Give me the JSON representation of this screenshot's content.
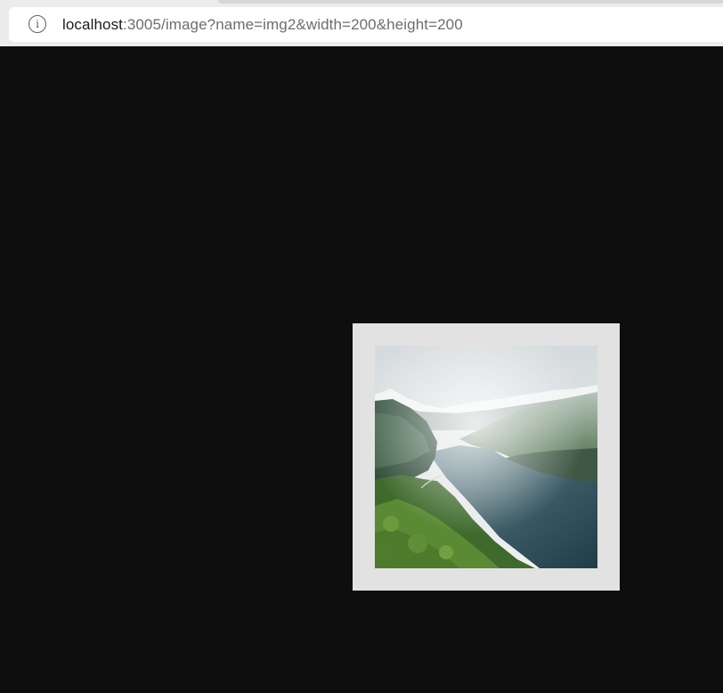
{
  "browser": {
    "address_bar": {
      "host": "localhost",
      "rest": ":3005/image?name=img2&width=200&height=200",
      "icon": "info-icon"
    }
  },
  "page": {
    "background_color": "#0e0e0e",
    "image": {
      "name": "img2",
      "frame_color": "#e2e2e2",
      "subject": "fjord-landscape-photo"
    }
  }
}
